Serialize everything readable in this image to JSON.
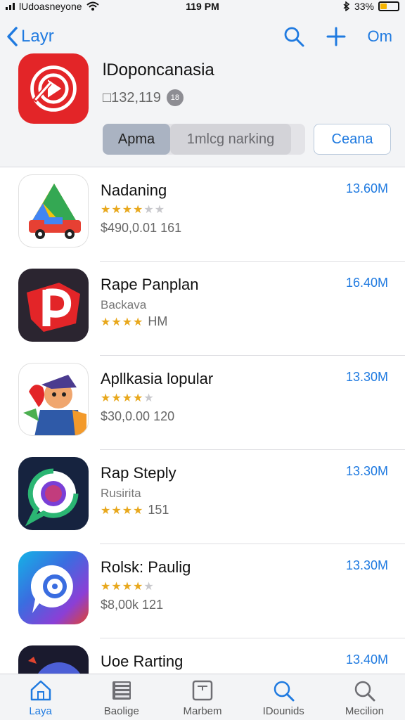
{
  "status_bar": {
    "carrier": "lUdoasneyone",
    "time": "119 PM",
    "battery": "33%"
  },
  "nav": {
    "back_label": "Layr",
    "right_label": "Om"
  },
  "hero": {
    "title": "lDoponcanasia",
    "count": "□132,119",
    "badge": "18"
  },
  "segments": {
    "active": "Apma",
    "inactive": "1mlcg narking"
  },
  "cancel_label": "Ceana",
  "apps": [
    {
      "name": "Nadaning",
      "meta1": "",
      "meta2": "$490,0.01 161",
      "size": "13.60M",
      "stars": 3.5
    },
    {
      "name": "Rape Panplan",
      "meta1": "Backava",
      "meta2": "HM",
      "size": "16.40M",
      "stars": 4
    },
    {
      "name": "Apllkasia lopular",
      "meta1": "",
      "meta2": "$30,0.00 120",
      "size": "13.30M",
      "stars": 3.5
    },
    {
      "name": "Rap Steply",
      "meta1": "Rusirita",
      "meta2": "151",
      "size": "13.30M",
      "stars": 4
    },
    {
      "name": "Rolsk: Paulig",
      "meta1": "",
      "meta2": "$8,00k 121",
      "size": "13.30M",
      "stars": 3.5
    },
    {
      "name": "Uoe Rarting",
      "meta1": "",
      "meta2": "",
      "size": "13.40M",
      "stars": 0
    }
  ],
  "tabs": [
    {
      "label": "Laya",
      "icon": "home-icon"
    },
    {
      "label": "Baolige",
      "icon": "book-icon"
    },
    {
      "label": "Marbem",
      "icon": "frame-icon"
    },
    {
      "label": "IDounids",
      "icon": "search-icon"
    },
    {
      "label": "Mecilion",
      "icon": "search-icon"
    }
  ],
  "colors": {
    "accent": "#1f7ae0",
    "hero_icon": "#e32528",
    "star": "#e8a81d"
  }
}
